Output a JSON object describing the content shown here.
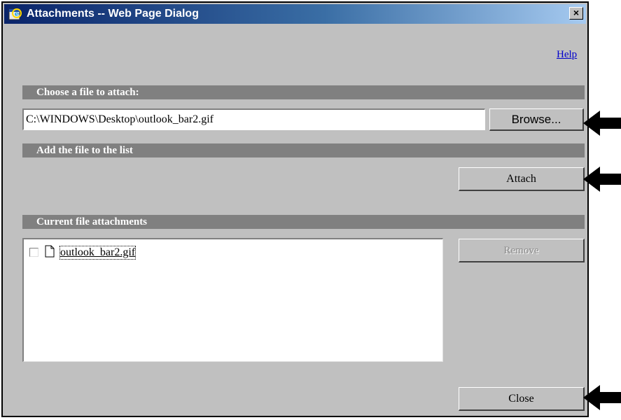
{
  "window": {
    "title": "Attachments -- Web Page Dialog",
    "close_glyph": "×"
  },
  "help_label": "Help",
  "sections": {
    "choose": "Choose a file to attach:",
    "add": "Add the file to the list",
    "current": "Current file attachments"
  },
  "file_path": "C:\\WINDOWS\\Desktop\\outlook_bar2.gif",
  "buttons": {
    "browse": "Browse...",
    "attach": "Attach",
    "remove": "Remove",
    "close": "Close"
  },
  "attachments": [
    {
      "name": "outlook_bar2.gif",
      "checked": false
    }
  ],
  "icons": {
    "title": "ie-dialog-icon",
    "file": "document-icon",
    "callout": "arrow-left-icon"
  },
  "colors": {
    "dialog_bg": "#c0c0c0",
    "section_bg": "#808080",
    "title_start": "#0a246a",
    "title_end": "#a6caf0",
    "link": "#0000cc"
  }
}
